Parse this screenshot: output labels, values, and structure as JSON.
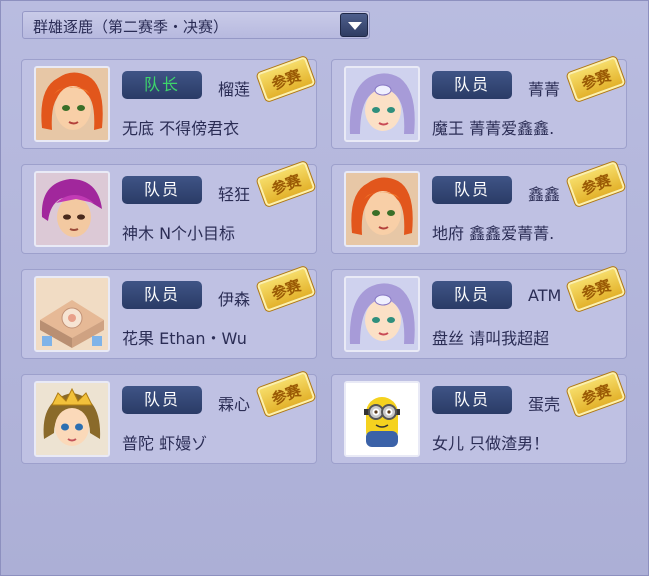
{
  "dropdown": {
    "label": "群雄逐鹿（第二赛季・决赛）",
    "icon": "chevron-down-icon"
  },
  "stamp_label": "参赛",
  "members": [
    {
      "role": "队长",
      "is_leader": true,
      "nickname": "榴莲",
      "title": "无底 不得傍君衣",
      "avatar": "orange-hair-woman"
    },
    {
      "role": "队员",
      "is_leader": false,
      "nickname": "菁菁",
      "title": "魔王 菁菁爱鑫鑫.",
      "avatar": "purple-hair-girl"
    },
    {
      "role": "队员",
      "is_leader": false,
      "nickname": "轻狂",
      "title": "神木 N个小目标",
      "avatar": "magenta-hair-boy"
    },
    {
      "role": "队员",
      "is_leader": false,
      "nickname": "鑫鑫",
      "title": "地府 鑫鑫爱菁菁.",
      "avatar": "orange-hair-woman"
    },
    {
      "role": "队员",
      "is_leader": false,
      "nickname": "伊森",
      "title": "花果 Ethan・Wu",
      "avatar": "scene-thumbnail"
    },
    {
      "role": "队员",
      "is_leader": false,
      "nickname": "ATM",
      "title": "盘丝 请叫我超超",
      "avatar": "purple-hair-girl"
    },
    {
      "role": "队员",
      "is_leader": false,
      "nickname": "霖心",
      "title": "普陀 虾嫚ゾ",
      "avatar": "crowned-girl"
    },
    {
      "role": "队员",
      "is_leader": false,
      "nickname": "蛋壳",
      "title": "女儿 只做渣男！",
      "avatar": "minion"
    }
  ]
}
